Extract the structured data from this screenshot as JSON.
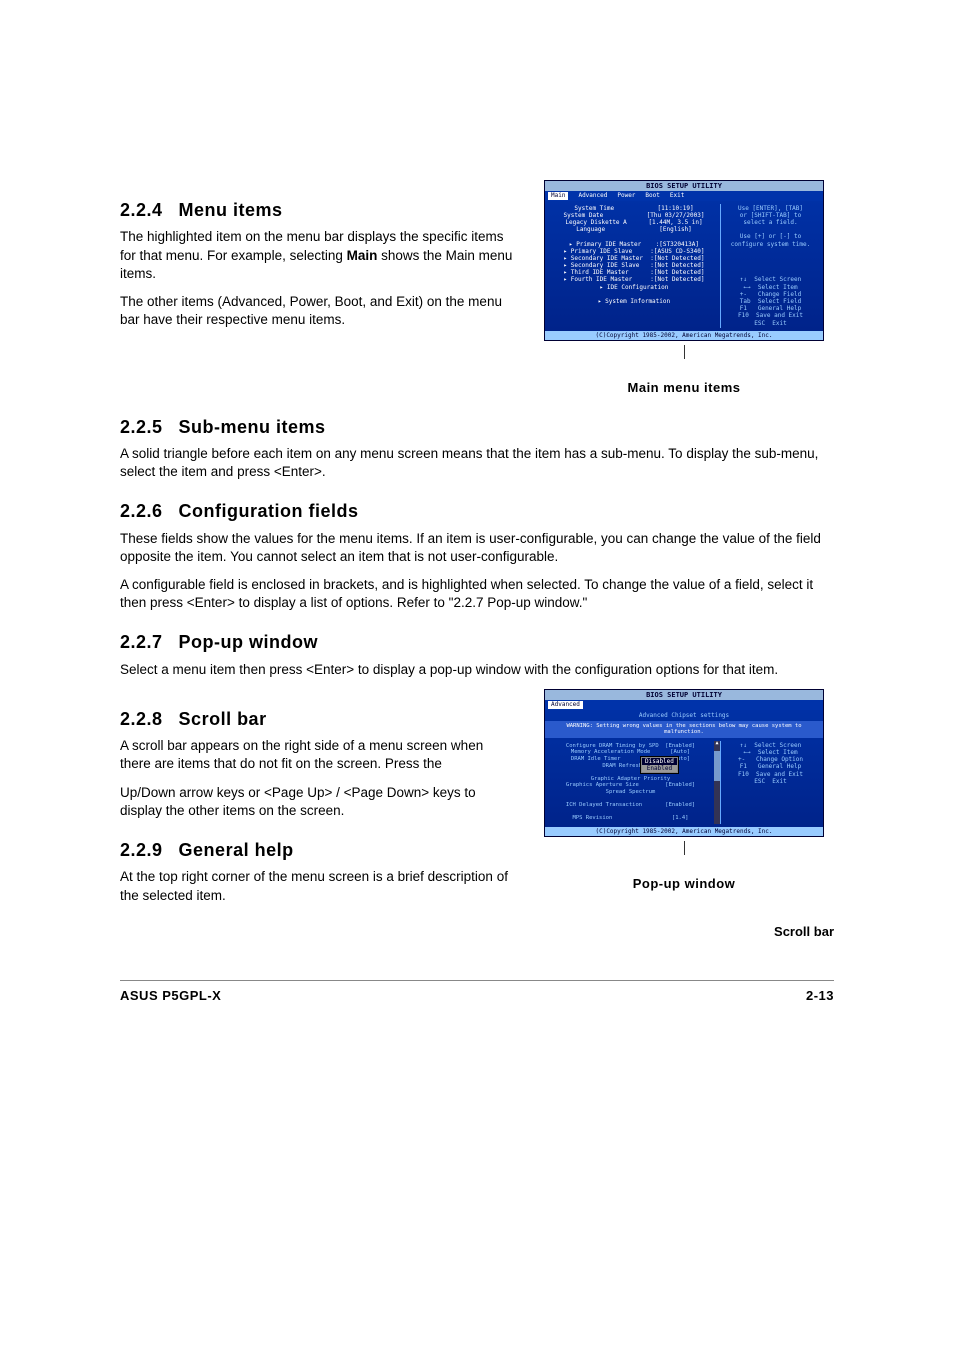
{
  "s224": {
    "num": "2.2.4",
    "title": "Menu items",
    "p1a": "The highlighted item on the menu bar displays the specific items for that menu. For example, selecting ",
    "p1bold": "Main",
    "p1b": " shows the Main menu items.",
    "p2": "The other items (Advanced, Power, Boot, and Exit) on the menu bar have their respective menu items."
  },
  "main_menu_caption": "Main menu items",
  "s225": {
    "num": "2.2.5",
    "title": "Sub-menu items",
    "p1": "A solid triangle before each item on any menu screen means that the item has a sub-menu. To display the sub-menu, select the item and press <Enter>."
  },
  "s226": {
    "num": "2.2.6",
    "title": "Configuration fields",
    "p1": "These fields show the values for the menu items. If an item is user-configurable, you can change the value of the field opposite the item. You cannot select an item that is not user-configurable.",
    "p2": "A configurable field is enclosed in brackets, and is highlighted when selected. To change the value of a field, select it then press <Enter> to display a list of options. Refer to \"2.2.7 Pop-up window.\""
  },
  "s227": {
    "num": "2.2.7",
    "title": "Pop-up window",
    "p1": "Select a menu item then press <Enter> to display a pop-up window with the configuration options for that item."
  },
  "s228": {
    "num": "2.2.8",
    "title": "Scroll bar",
    "p1": "A scroll bar appears on the right side of a menu screen when there are items that do not fit on the screen. Press the",
    "p2": "Up/Down arrow keys or <Page Up> / <Page Down> keys to display the other items on the screen."
  },
  "s229": {
    "num": "2.2.9",
    "title": "General help",
    "p1": "At the top right corner of the menu screen is a brief description of the selected item."
  },
  "popup_caption": "Pop-up window",
  "scrollbar_caption": "Scroll bar",
  "bios1": {
    "header": "BIOS SETUP UTILITY",
    "menu": {
      "main": "Main",
      "advanced": "Advanced",
      "power": "Power",
      "boot": "Boot",
      "exit": "Exit"
    },
    "rows": "System Time            [11:10:19]\nSystem Date            [Thu 03/27/2003]\nLegacy Diskette A      [1.44M, 3.5 in]\nLanguage               [English]\n\n▸ Primary IDE Master    :[ST320413A]\n▸ Primary IDE Slave     :[ASUS CD-S340]\n▸ Secondary IDE Master  :[Not Detected]\n▸ Secondary IDE Slave   :[Not Detected]\n▸ Third IDE Master      :[Not Detected]\n▸ Fourth IDE Master     :[Not Detected]\n▸ IDE Configuration\n\n▸ System Information",
    "help": "Use [ENTER], [TAB]\nor [SHIFT-TAB] to\nselect a field.\n\nUse [+] or [-] to\nconfigure system time.\n\n\n\n\n↑↓  Select Screen\n←→  Select Item\n+-   Change Field\nTab  Select Field\nF1   General Help\nF10  Save and Exit\nESC  Exit",
    "footer": "(C)Copyright 1985-2002, American Megatrends, Inc."
  },
  "bios2": {
    "header": "BIOS SETUP UTILITY",
    "menu_selected": "Advanced",
    "title_row": "Advanced Chipset settings",
    "warning": "WARNING: Setting wrong values in the sections below may cause system to malfunction.",
    "rows": "Configure DRAM Timing by SPD  [Enabled]\nMemory Acceleration Mode      [Auto]\nDRAM Idle Timer               [Auto]\nDRAM Refresh Rate\n\nGraphic Adapter Priority\nGraphics Aperture Size        [Enabled]\nSpread Spectrum\n\nICH Delayed Transaction       [Enabled]\n\nMPS Revision                  [1.4]",
    "popup_opts": {
      "disabled": "Disabled",
      "enabled": "Enabled"
    },
    "help": "↑↓  Select Screen\n←→  Select Item\n+-   Change Option\nF1   General Help\nF10  Save and Exit\nESC  Exit",
    "footer": "(C)Copyright 1985-2002, American Megatrends, Inc."
  },
  "footer": {
    "left": "ASUS P5GPL-X",
    "right": "2-13"
  }
}
